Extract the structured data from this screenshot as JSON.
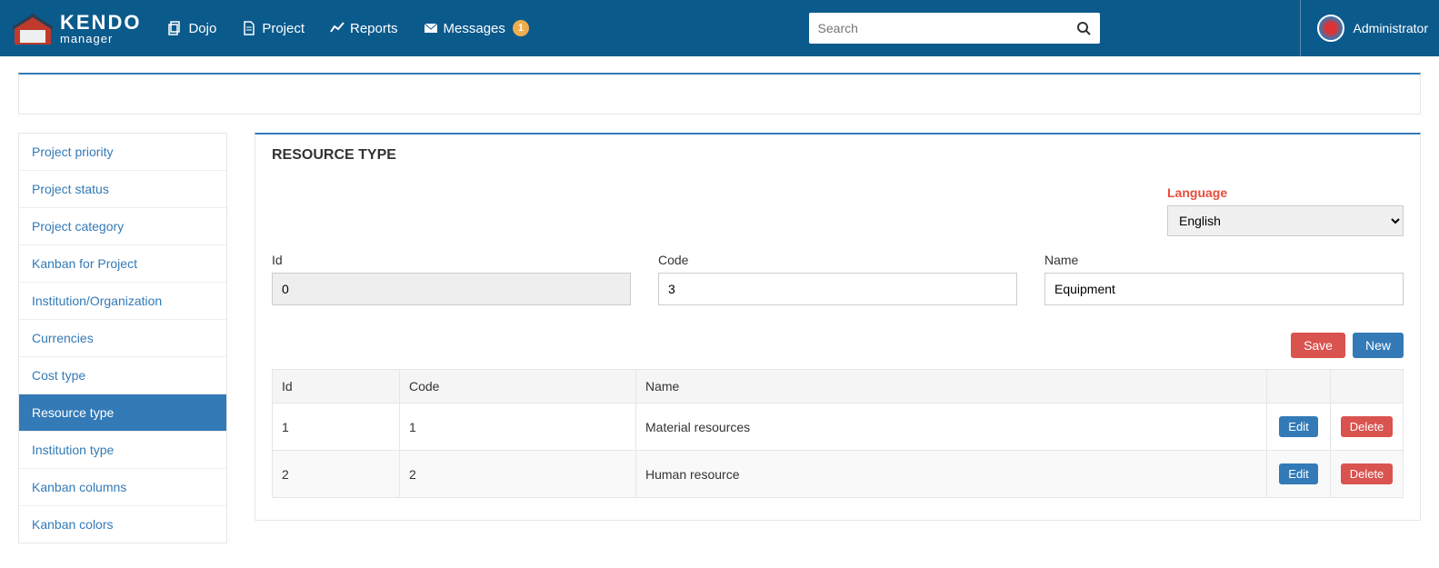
{
  "nav": {
    "dojo": "Dojo",
    "project": "Project",
    "reports": "Reports",
    "messages": "Messages",
    "messages_badge": "1"
  },
  "search": {
    "placeholder": "Search"
  },
  "user": {
    "name": "Administrator"
  },
  "sidebar": {
    "items": [
      {
        "label": "Project priority"
      },
      {
        "label": "Project status"
      },
      {
        "label": "Project category"
      },
      {
        "label": "Kanban for Project"
      },
      {
        "label": "Institution/Organization"
      },
      {
        "label": "Currencies"
      },
      {
        "label": "Cost type"
      },
      {
        "label": "Resource type",
        "active": true
      },
      {
        "label": "Institution type"
      },
      {
        "label": "Kanban columns"
      },
      {
        "label": "Kanban colors"
      }
    ]
  },
  "main": {
    "title": "RESOURCE TYPE",
    "language_label": "Language",
    "language_value": "English",
    "form": {
      "id_label": "Id",
      "id_value": "0",
      "code_label": "Code",
      "code_value": "3",
      "name_label": "Name",
      "name_value": "Equipment"
    },
    "buttons": {
      "save": "Save",
      "new": "New",
      "edit": "Edit",
      "delete": "Delete"
    },
    "table": {
      "headers": {
        "id": "Id",
        "code": "Code",
        "name": "Name"
      },
      "rows": [
        {
          "id": "1",
          "code": "1",
          "name": "Material resources"
        },
        {
          "id": "2",
          "code": "2",
          "name": "Human resource"
        }
      ]
    }
  }
}
